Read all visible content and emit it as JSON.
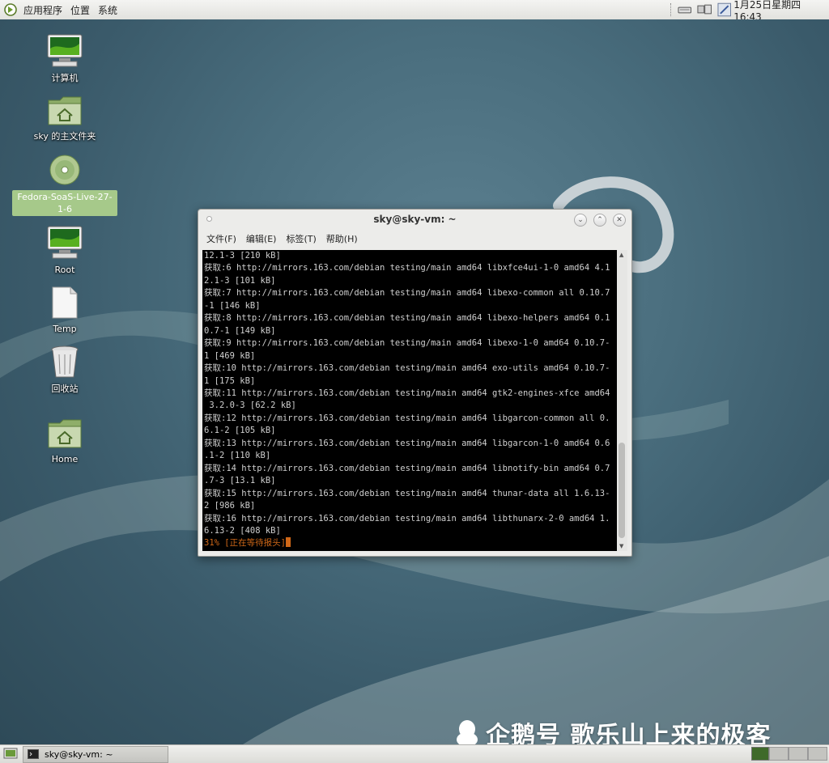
{
  "top_panel": {
    "menus": [
      "应用程序",
      "位置",
      "系统"
    ],
    "clock": "1月25日星期四 16:43"
  },
  "desktop_icons": [
    {
      "label": "计算机",
      "icon": "computer-icon"
    },
    {
      "label": "sky 的主文件夹",
      "icon": "home-folder-icon"
    },
    {
      "label": "Fedora-SoaS-Live-27-1-6",
      "icon": "optical-disc-icon",
      "selected": true
    },
    {
      "label": "Root",
      "icon": "computer-icon"
    },
    {
      "label": "Temp",
      "icon": "document-icon"
    },
    {
      "label": "回收站",
      "icon": "trash-icon"
    },
    {
      "label": "Home",
      "icon": "home-folder-icon"
    }
  ],
  "terminal": {
    "title": "sky@sky-vm: ~",
    "menu": [
      "文件(F)",
      "编辑(E)",
      "标签(T)",
      "帮助(H)"
    ],
    "lines": [
      "12.1-3 [210 kB]",
      "获取:6 http://mirrors.163.com/debian testing/main amd64 libxfce4ui-1-0 amd64 4.1",
      "2.1-3 [101 kB]",
      "获取:7 http://mirrors.163.com/debian testing/main amd64 libexo-common all 0.10.7",
      "-1 [146 kB]",
      "获取:8 http://mirrors.163.com/debian testing/main amd64 libexo-helpers amd64 0.1",
      "0.7-1 [149 kB]",
      "获取:9 http://mirrors.163.com/debian testing/main amd64 libexo-1-0 amd64 0.10.7-",
      "1 [469 kB]",
      "获取:10 http://mirrors.163.com/debian testing/main amd64 exo-utils amd64 0.10.7-",
      "1 [175 kB]",
      "获取:11 http://mirrors.163.com/debian testing/main amd64 gtk2-engines-xfce amd64",
      " 3.2.0-3 [62.2 kB]",
      "获取:12 http://mirrors.163.com/debian testing/main amd64 libgarcon-common all 0.",
      "6.1-2 [105 kB]",
      "获取:13 http://mirrors.163.com/debian testing/main amd64 libgarcon-1-0 amd64 0.6",
      ".1-2 [110 kB]",
      "获取:14 http://mirrors.163.com/debian testing/main amd64 libnotify-bin amd64 0.7",
      ".7-3 [13.1 kB]",
      "获取:15 http://mirrors.163.com/debian testing/main amd64 thunar-data all 1.6.13-",
      "2 [986 kB]",
      "获取:16 http://mirrors.163.com/debian testing/main amd64 libthunarx-2-0 amd64 1.",
      "6.13-2 [408 kB]"
    ],
    "status": "31% [正在等待报头]"
  },
  "taskbar": {
    "task_label": "sky@sky-vm: ~"
  },
  "watermark": "企鹅号 歌乐山上来的极客"
}
